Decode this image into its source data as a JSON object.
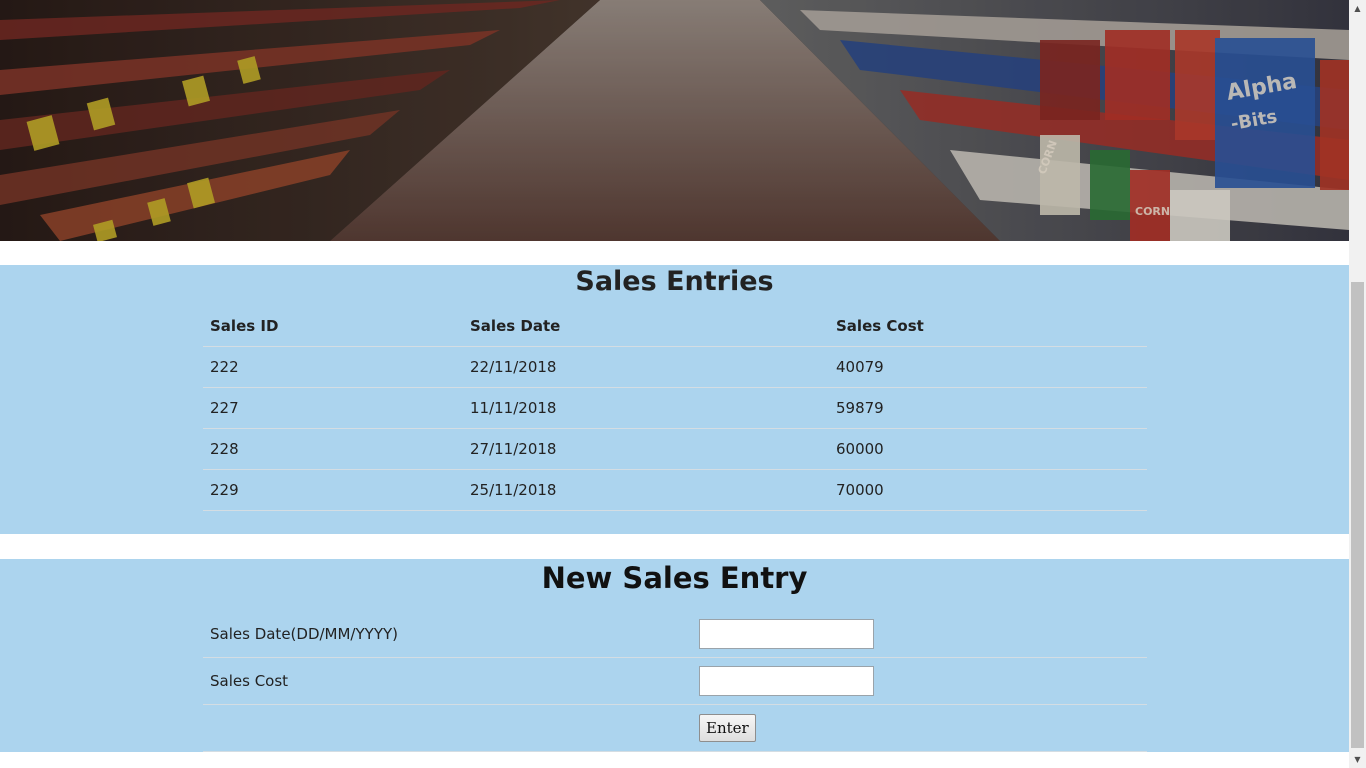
{
  "entries": {
    "title": "Sales Entries",
    "columns": [
      "Sales ID",
      "Sales Date",
      "Sales Cost"
    ],
    "rows": [
      [
        "222",
        "22/11/2018",
        "40079"
      ],
      [
        "227",
        "11/11/2018",
        "59879"
      ],
      [
        "228",
        "27/11/2018",
        "60000"
      ],
      [
        "229",
        "25/11/2018",
        "70000"
      ]
    ]
  },
  "new_entry": {
    "title": "New Sales Entry",
    "date_label": "Sales Date(DD/MM/YYYY)",
    "date_value": "",
    "cost_label": "Sales Cost",
    "cost_value": "",
    "enter_label": "Enter"
  },
  "colors": {
    "band": "#acd4ee",
    "hero": "#3a2f2a"
  },
  "icons": {
    "scroll_up": "up-arrow-icon",
    "scroll_down": "down-arrow-icon"
  }
}
